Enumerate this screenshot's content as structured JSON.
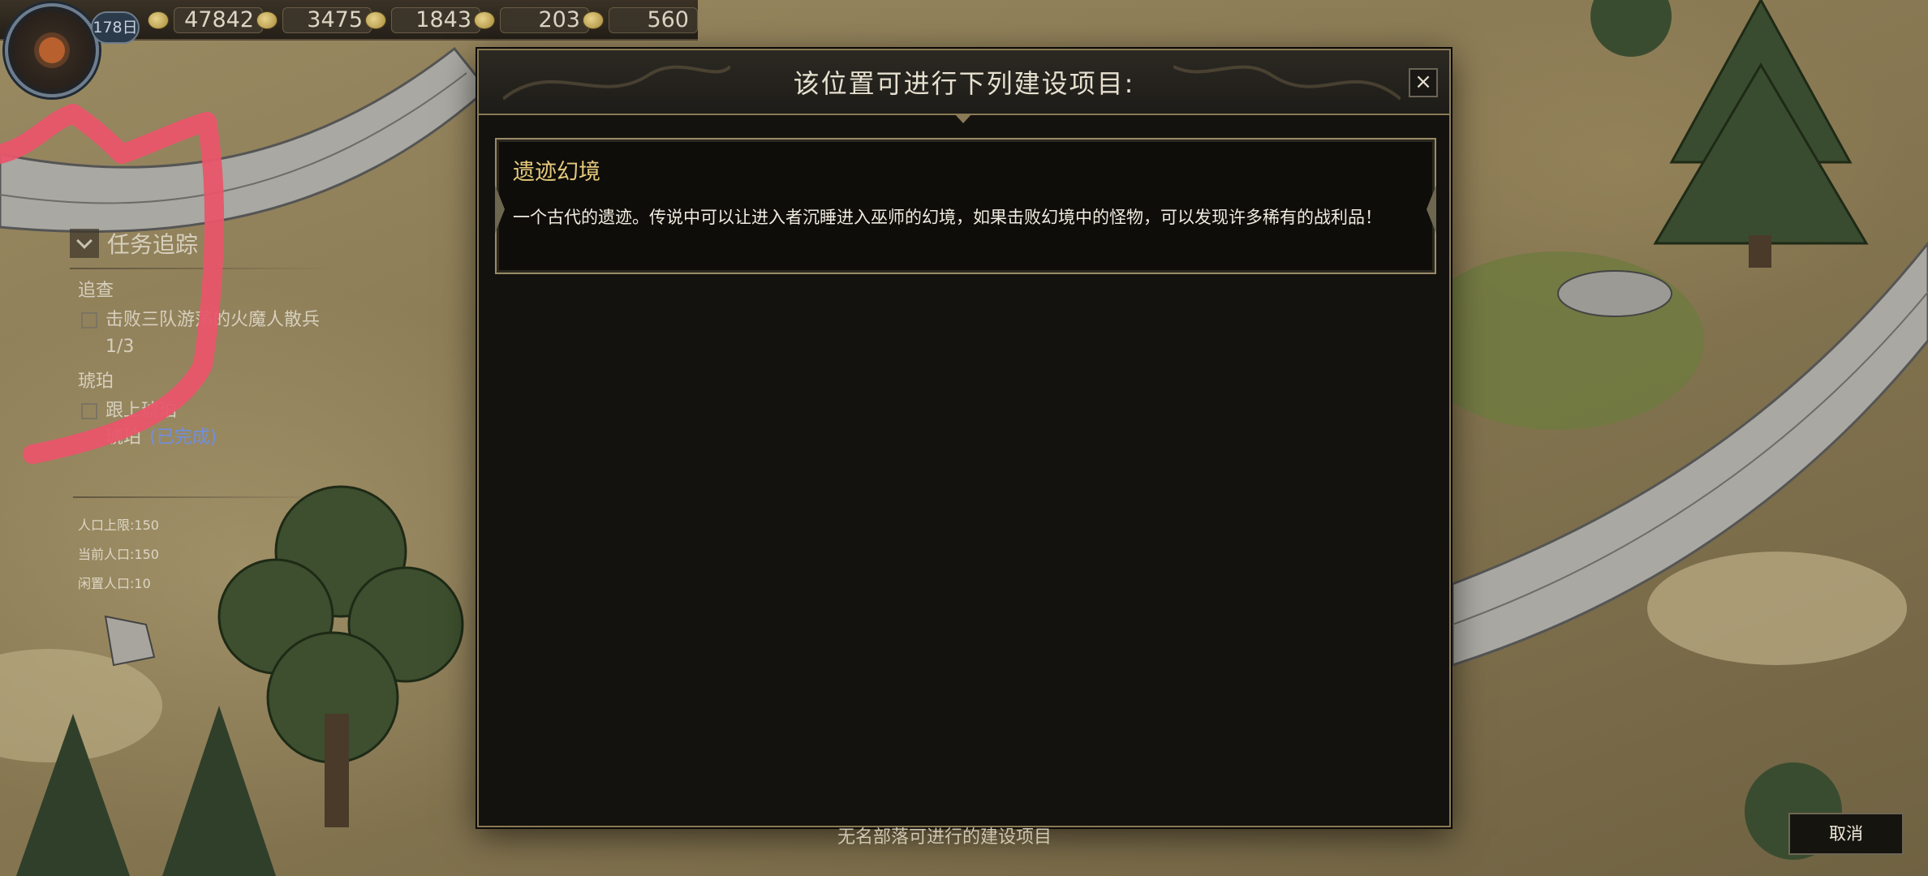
{
  "hud": {
    "day": "178日",
    "resources": [
      {
        "icon": "coin-icon",
        "value": "47842"
      },
      {
        "icon": "ore-icon",
        "value": "3475"
      },
      {
        "icon": "ingot-icon",
        "value": "1843"
      },
      {
        "icon": "bag-icon",
        "value": "203"
      },
      {
        "icon": "horn-icon",
        "value": "560"
      }
    ]
  },
  "quest": {
    "title": "任务追踪",
    "categories": [
      {
        "name": "追查",
        "items": [
          "击败三队游荡的火魔人散兵 1/3"
        ]
      },
      {
        "name": "琥珀",
        "items": [
          "跟上琥珀"
        ]
      }
    ],
    "extra_item": "琥珀",
    "extra_status": "(已完成)"
  },
  "population": {
    "max": "人口上限:150",
    "current": "当前人口:150",
    "idle": "闲置人口:10"
  },
  "modal": {
    "title": "该位置可进行下列建设项目:",
    "close_label": "×",
    "project": {
      "name": "遗迹幻境",
      "description": "一个古代的遗迹。传说中可以让进入者沉睡进入巫师的幻境，如果击败幻境中的怪物，可以发现许多稀有的战利品！"
    }
  },
  "bottom": {
    "hint": "无名部落可进行的建设项目",
    "cancel_label": "取消"
  },
  "colors": {
    "modal_border": "#8a7a55",
    "project_name": "#e5c97a",
    "done_status": "#6f8fe0",
    "annotation_red": "#e8556a"
  }
}
